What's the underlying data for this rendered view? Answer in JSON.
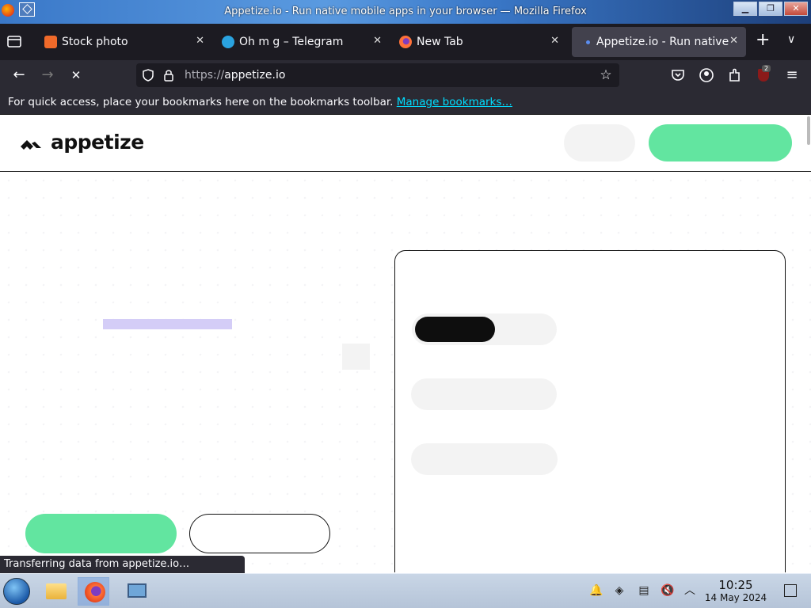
{
  "window": {
    "title": "Appetize.io - Run native mobile apps in your browser — Mozilla Firefox",
    "controls": {
      "minimize": "▁",
      "maximize": "❐",
      "close": "✕"
    }
  },
  "tabs": [
    {
      "label": "Stock photo",
      "color": "#f06a2a"
    },
    {
      "label": "Oh m g – Telegram",
      "color": "#2aa3e0"
    },
    {
      "label": "New Tab",
      "color": "#ff7139"
    },
    {
      "label": "Appetize.io - Run native",
      "color": "#5b8def",
      "active": true
    }
  ],
  "toolbar": {
    "back": "←",
    "forward": "→",
    "stop": "✕",
    "url_scheme": "https://",
    "url_host": "appetize.io",
    "extension_badge": "2"
  },
  "bookmarks_bar": {
    "message": "For quick access, place your bookmarks here on the bookmarks toolbar.",
    "link": "Manage bookmarks…"
  },
  "site": {
    "brand": "appetize",
    "accent_green": "#62e5a0",
    "accent_purple": "#d4cdf7"
  },
  "status_bar": {
    "text": "Transferring data from appetize.io…"
  },
  "taskbar": {
    "time": "10:25",
    "date": "14 May 2024"
  }
}
